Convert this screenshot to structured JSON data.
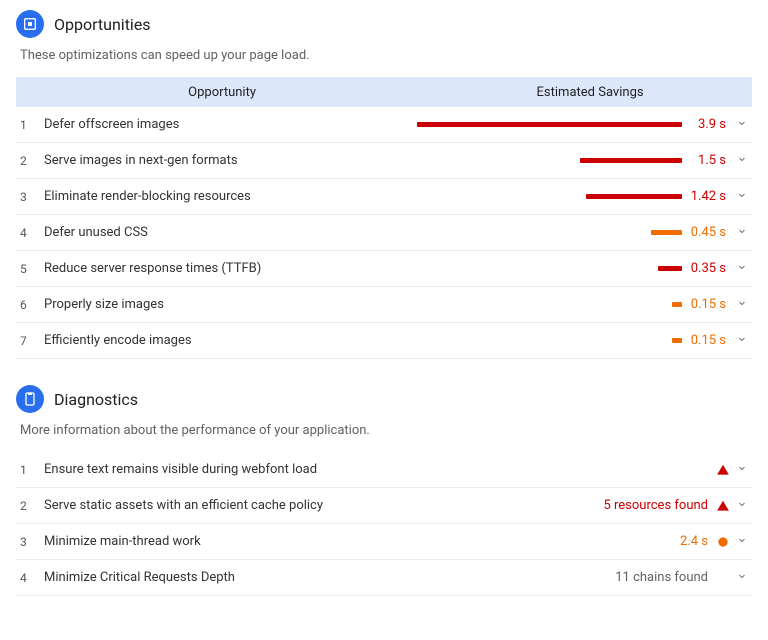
{
  "opportunities": {
    "title": "Opportunities",
    "subtitle": "These optimizations can speed up your page load.",
    "col_opportunity": "Opportunity",
    "col_savings": "Estimated Savings",
    "max_seconds": 3.9,
    "rows": [
      {
        "idx": "1",
        "label": "Defer offscreen images",
        "seconds": 3.9,
        "display": "3.9 s",
        "severity": "red"
      },
      {
        "idx": "2",
        "label": "Serve images in next-gen formats",
        "seconds": 1.5,
        "display": "1.5 s",
        "severity": "red"
      },
      {
        "idx": "3",
        "label": "Eliminate render-blocking resources",
        "seconds": 1.42,
        "display": "1.42 s",
        "severity": "red"
      },
      {
        "idx": "4",
        "label": "Defer unused CSS",
        "seconds": 0.45,
        "display": "0.45 s",
        "severity": "orange"
      },
      {
        "idx": "5",
        "label": "Reduce server response times (TTFB)",
        "seconds": 0.35,
        "display": "0.35 s",
        "severity": "red"
      },
      {
        "idx": "6",
        "label": "Properly size images",
        "seconds": 0.15,
        "display": "0.15 s",
        "severity": "orange"
      },
      {
        "idx": "7",
        "label": "Efficiently encode images",
        "seconds": 0.15,
        "display": "0.15 s",
        "severity": "orange"
      }
    ]
  },
  "diagnostics": {
    "title": "Diagnostics",
    "subtitle": "More information about the performance of your application.",
    "rows": [
      {
        "idx": "1",
        "label": "Ensure text remains visible during webfont load",
        "value": "",
        "value_color": "",
        "icon": "triangle-red"
      },
      {
        "idx": "2",
        "label": "Serve static assets with an efficient cache policy",
        "value": "5 resources found",
        "value_color": "red",
        "icon": "triangle-red"
      },
      {
        "idx": "3",
        "label": "Minimize main-thread work",
        "value": "2.4 s",
        "value_color": "orange",
        "icon": "circle-orange"
      },
      {
        "idx": "4",
        "label": "Minimize Critical Requests Depth",
        "value": "11 chains found",
        "value_color": "gray",
        "icon": ""
      }
    ]
  }
}
